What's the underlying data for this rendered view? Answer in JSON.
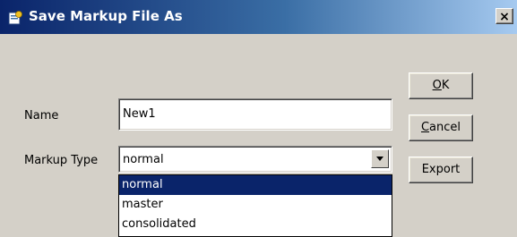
{
  "window": {
    "title": "Save Markup File As",
    "close_label": "×"
  },
  "form": {
    "name_label": "Name",
    "name_value": "New1",
    "type_label": "Markup Type",
    "type_value": "normal"
  },
  "dropdown": {
    "options": [
      "normal",
      "master",
      "consolidated"
    ],
    "selected_index": 0
  },
  "buttons": {
    "ok": {
      "mnemonic": "O",
      "rest": "K"
    },
    "cancel": {
      "mnemonic": "C",
      "rest": "ancel"
    },
    "export": "Export"
  },
  "colors": {
    "titlebar_start": "#0a246a",
    "titlebar_end": "#a6caf0",
    "dialog_bg": "#d4d0c8",
    "selection": "#0a246a"
  }
}
